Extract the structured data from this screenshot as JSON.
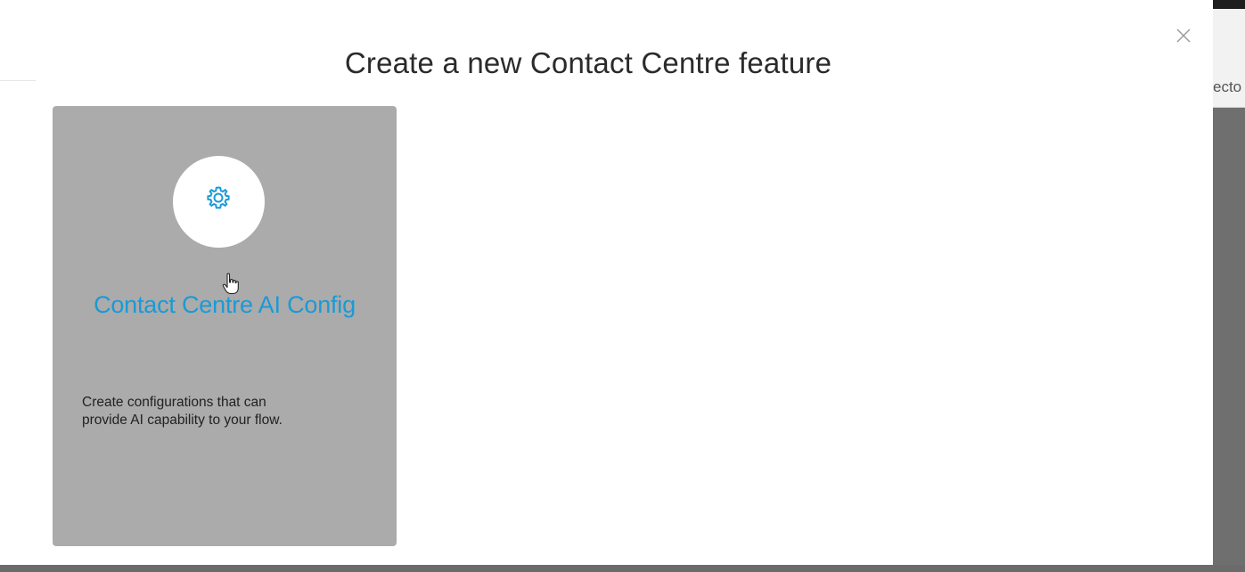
{
  "modal": {
    "title": "Create a new Contact Centre feature",
    "close_icon": "close-icon"
  },
  "background": {
    "partial_text": "ecto"
  },
  "feature_cards": [
    {
      "icon": "gear-icon",
      "title": "Contact Centre AI Config",
      "description_line1": "Create configurations that can",
      "description_line2": "provide AI capability to your flow."
    }
  ],
  "colors": {
    "accent": "#1a9ad6",
    "card_background": "#ababab",
    "title_text": "#2b2b2b"
  }
}
